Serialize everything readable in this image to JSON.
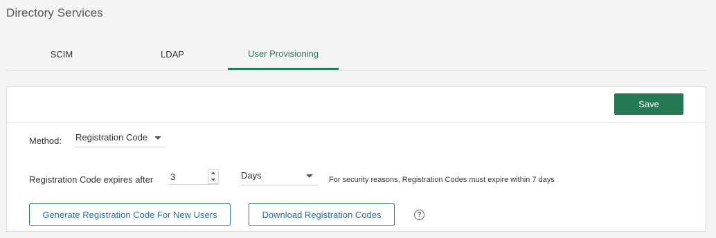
{
  "page": {
    "title": "Directory Services"
  },
  "tabs": [
    {
      "label": "SCIM"
    },
    {
      "label": "LDAP"
    },
    {
      "label": "User Provisioning"
    }
  ],
  "toolbar": {
    "save_label": "Save"
  },
  "form": {
    "method": {
      "label": "Method:",
      "value": "Registration Code"
    },
    "expiry": {
      "label": "Registration Code expires after",
      "value": "3",
      "unit": "Days",
      "note": "For security reasons, Registration Codes must expire within 7 days"
    }
  },
  "actions": {
    "generate_label": "Generate Registration Code For New Users",
    "download_label": "Download Registration Codes",
    "help_glyph": "?"
  },
  "colors": {
    "accent": "#237a55",
    "link": "#2b6fa3"
  }
}
